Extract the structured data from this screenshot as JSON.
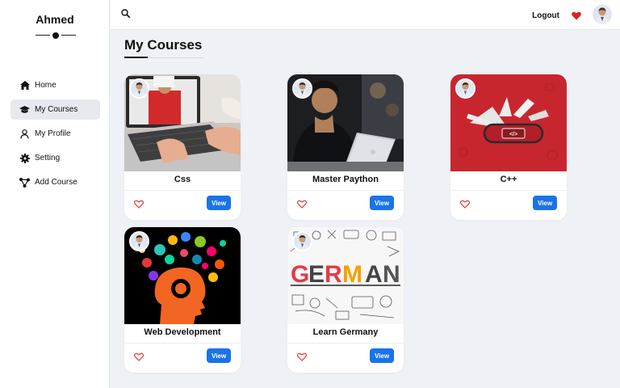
{
  "sidebar": {
    "brand": "Ahmed",
    "items": [
      {
        "label": "Home",
        "icon": "home-icon"
      },
      {
        "label": "My Courses",
        "icon": "graduation-cap-icon",
        "active": true
      },
      {
        "label": "My Profile",
        "icon": "user-icon"
      },
      {
        "label": "Setting",
        "icon": "gear-icon"
      },
      {
        "label": "Add Course",
        "icon": "network-icon"
      }
    ]
  },
  "topbar": {
    "logout_label": "Logout",
    "heart_color": "#e0201b"
  },
  "main": {
    "title": "My Courses",
    "view_label": "View",
    "courses": [
      {
        "title": "Css"
      },
      {
        "title": "Master Paython"
      },
      {
        "title": "C++"
      },
      {
        "title": "Web Development"
      },
      {
        "title": "Learn Germany"
      }
    ]
  },
  "colors": {
    "accent": "#1a73e8",
    "heart_outline": "#e53935",
    "background": "#eef1f6"
  }
}
